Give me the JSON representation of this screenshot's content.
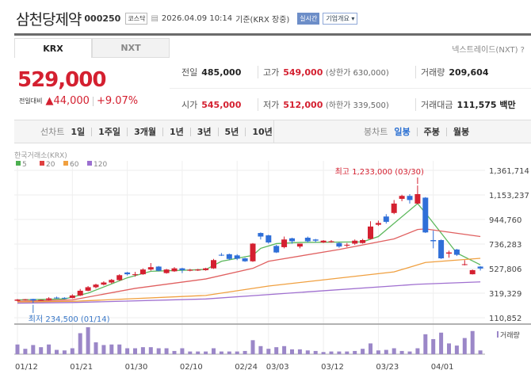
{
  "header": {
    "name": "삼천당제약",
    "code": "000250",
    "market": "코스닥",
    "datetime": "2026.04.09 10:14",
    "basis": "기준(KRX 장중)",
    "realtime": "실시간",
    "company_info": "기업개요 ▾"
  },
  "tabs": [
    {
      "label": "KRX",
      "active": true
    },
    {
      "label": "NXT",
      "active": false
    }
  ],
  "nxt_link": "넥스트레이드(NXT) ?",
  "quote": {
    "price": "529,000",
    "change_label": "전일대비",
    "change": "▲44,000",
    "change_pct": "+9.07%"
  },
  "stats": {
    "prev": {
      "k": "전일",
      "v": "485,000"
    },
    "high": {
      "k": "고가",
      "v": "549,000",
      "s": "(상한가 630,000)"
    },
    "volume": {
      "k": "거래량",
      "v": "209,604"
    },
    "open": {
      "k": "시가",
      "v": "545,000"
    },
    "low": {
      "k": "저가",
      "v": "512,000",
      "s": "(하한가 339,500)"
    },
    "amount": {
      "k": "거래대금",
      "v": "111,575 백만"
    }
  },
  "period_bar": {
    "line_label": "선차트",
    "line_items": [
      "1일",
      "1주일",
      "3개월",
      "1년",
      "3년",
      "5년",
      "10년"
    ],
    "candle_label": "봉차트",
    "candle_items": [
      "일봉",
      "주봉",
      "월봉"
    ],
    "selected": "일봉"
  },
  "colors": {
    "up": "#d42030",
    "down": "#2f6fd8",
    "ma5": "#5cb85c",
    "ma20": "#e06060",
    "ma60": "#f0a040",
    "ma120": "#a070d0",
    "volume": "#9b87c8"
  },
  "chart_data": {
    "type": "candlestick",
    "source": "한국거래소(KRX)",
    "legend": [
      {
        "name": "5",
        "color": "#4caf50"
      },
      {
        "name": "20",
        "color": "#e04040"
      },
      {
        "name": "60",
        "color": "#f0a040"
      },
      {
        "name": "120",
        "color": "#9b6fd0"
      }
    ],
    "y_ticks": [
      "1,361,714",
      "1,153,237",
      "944,760",
      "736,283",
      "527,806",
      "319,329",
      "110,852"
    ],
    "ylim": [
      110852,
      1361714
    ],
    "x_ticks": [
      "01/12",
      "01/21",
      "01/30",
      "02/10",
      "02/24",
      "03/03",
      "03/12",
      "03/23",
      "04/01"
    ],
    "dates": [
      "01/12",
      "01/13",
      "01/14",
      "01/15",
      "01/16",
      "01/19",
      "01/20",
      "01/21",
      "01/22",
      "01/23",
      "01/26",
      "01/27",
      "01/28",
      "01/29",
      "01/30",
      "02/02",
      "02/03",
      "02/04",
      "02/05",
      "02/06",
      "02/09",
      "02/10",
      "02/11",
      "02/12",
      "02/13",
      "02/19",
      "02/20",
      "02/23",
      "02/24",
      "02/25",
      "02/26",
      "02/27",
      "03/03",
      "03/04",
      "03/05",
      "03/06",
      "03/09",
      "03/10",
      "03/11",
      "03/12",
      "03/13",
      "03/16",
      "03/17",
      "03/18",
      "03/19",
      "03/20",
      "03/23",
      "03/24",
      "03/25",
      "03/26",
      "03/27",
      "03/30",
      "03/31",
      "04/01",
      "04/02",
      "04/03",
      "04/06",
      "04/07",
      "04/08",
      "04/09"
    ],
    "ohlc": [
      [
        255000,
        270000,
        250000,
        265000
      ],
      [
        262000,
        270000,
        258000,
        268000
      ],
      [
        270000,
        272000,
        234500,
        258000
      ],
      [
        260000,
        265000,
        255000,
        262000
      ],
      [
        262000,
        285000,
        258000,
        275000
      ],
      [
        282000,
        290000,
        272000,
        278000
      ],
      [
        280000,
        285000,
        270000,
        276000
      ],
      [
        278000,
        310000,
        275000,
        300000
      ],
      [
        300000,
        355000,
        295000,
        340000
      ],
      [
        340000,
        380000,
        335000,
        370000
      ],
      [
        370000,
        400000,
        360000,
        392000
      ],
      [
        392000,
        420000,
        385000,
        410000
      ],
      [
        410000,
        440000,
        400000,
        432000
      ],
      [
        430000,
        480000,
        425000,
        472000
      ],
      [
        495000,
        500000,
        470000,
        480000
      ],
      [
        475000,
        500000,
        460000,
        480000
      ],
      [
        480000,
        530000,
        475000,
        520000
      ],
      [
        520000,
        575000,
        510000,
        540000
      ],
      [
        545000,
        550000,
        505000,
        510000
      ],
      [
        490000,
        525000,
        485000,
        520000
      ],
      [
        505000,
        540000,
        500000,
        530000
      ],
      [
        530000,
        535000,
        490000,
        515000
      ],
      [
        510000,
        525000,
        505000,
        518000
      ],
      [
        512000,
        525000,
        508000,
        520000
      ],
      [
        515000,
        535000,
        510000,
        530000
      ],
      [
        530000,
        610000,
        525000,
        600000
      ],
      [
        645000,
        660000,
        635000,
        642000
      ],
      [
        650000,
        655000,
        600000,
        610000
      ],
      [
        640000,
        650000,
        600000,
        612000
      ],
      [
        615000,
        620000,
        585000,
        590000
      ],
      [
        590000,
        745000,
        585000,
        740000
      ],
      [
        830000,
        835000,
        775000,
        800000
      ],
      [
        810000,
        815000,
        740000,
        750000
      ],
      [
        720000,
        730000,
        660000,
        665000
      ],
      [
        710000,
        800000,
        700000,
        775000
      ],
      [
        785000,
        790000,
        740000,
        760000
      ],
      [
        715000,
        740000,
        700000,
        740000
      ],
      [
        790000,
        800000,
        750000,
        760000
      ],
      [
        775000,
        780000,
        750000,
        765000
      ],
      [
        750000,
        770000,
        745000,
        765000
      ],
      [
        752000,
        770000,
        748000,
        760000
      ],
      [
        745000,
        750000,
        705000,
        715000
      ],
      [
        725000,
        745000,
        710000,
        730000
      ],
      [
        740000,
        775000,
        730000,
        765000
      ],
      [
        745000,
        780000,
        740000,
        770000
      ],
      [
        780000,
        930000,
        775000,
        885000
      ],
      [
        900000,
        935000,
        890000,
        915000
      ],
      [
        970000,
        990000,
        910000,
        925000
      ],
      [
        1000000,
        1110000,
        990000,
        1080000
      ],
      [
        1120000,
        1155000,
        1100000,
        1145000
      ],
      [
        1145000,
        1160000,
        1080000,
        1110000
      ],
      [
        1080000,
        1233000,
        1075000,
        1160000
      ],
      [
        1130000,
        1135000,
        830000,
        835000
      ],
      [
        770000,
        850000,
        700000,
        760000
      ],
      [
        770000,
        775000,
        610000,
        615000
      ],
      [
        655000,
        680000,
        620000,
        665000
      ],
      [
        690000,
        695000,
        635000,
        645000
      ],
      [
        560000,
        600000,
        555000,
        565000
      ],
      [
        480000,
        520000,
        478000,
        515000
      ],
      [
        545000,
        549000,
        512000,
        529000
      ]
    ],
    "ma": {
      "5": [
        [
          "01/12",
          262000
        ],
        [
          "01/20",
          270000
        ],
        [
          "01/23",
          320000
        ],
        [
          "01/30",
          450000
        ],
        [
          "02/04",
          505000
        ],
        [
          "02/13",
          520000
        ],
        [
          "02/20",
          590000
        ],
        [
          "02/26",
          640000
        ],
        [
          "02/27",
          700000
        ],
        [
          "03/04",
          740000
        ],
        [
          "03/09",
          750000
        ],
        [
          "03/19",
          755000
        ],
        [
          "03/23",
          800000
        ],
        [
          "03/30",
          1080000
        ],
        [
          "03/31",
          1000000
        ],
        [
          "04/06",
          660000
        ],
        [
          "04/09",
          560000
        ]
      ],
      "20": [
        [
          "01/12",
          250000
        ],
        [
          "01/21",
          262000
        ],
        [
          "02/02",
          360000
        ],
        [
          "02/13",
          440000
        ],
        [
          "02/26",
          530000
        ],
        [
          "03/03",
          590000
        ],
        [
          "03/16",
          690000
        ],
        [
          "03/25",
          780000
        ],
        [
          "03/30",
          860000
        ],
        [
          "03/31",
          865000
        ],
        [
          "04/09",
          800000
        ]
      ],
      "60": [
        [
          "01/12",
          245000
        ],
        [
          "01/21",
          250000
        ],
        [
          "02/13",
          300000
        ],
        [
          "03/03",
          380000
        ],
        [
          "03/25",
          500000
        ],
        [
          "03/31",
          580000
        ],
        [
          "04/09",
          615000
        ]
      ],
      "120": [
        [
          "01/12",
          235000
        ],
        [
          "01/21",
          240000
        ],
        [
          "02/13",
          270000
        ],
        [
          "03/12",
          340000
        ],
        [
          "03/30",
          395000
        ],
        [
          "04/09",
          415000
        ]
      ]
    },
    "annotations": {
      "high": "최고 1,233,000 (03/30)",
      "low": "최저 234,500 (01/14)"
    },
    "volume_label": "거래량",
    "volume": [
      36,
      20,
      34,
      26,
      36,
      16,
      14,
      22,
      78,
      100,
      44,
      34,
      36,
      36,
      22,
      22,
      26,
      26,
      22,
      22,
      12,
      22,
      10,
      10,
      10,
      22,
      10,
      10,
      10,
      12,
      52,
      30,
      20,
      26,
      30,
      18,
      18,
      14,
      12,
      8,
      10,
      10,
      10,
      12,
      20,
      40,
      14,
      16,
      22,
      12,
      10,
      22,
      74,
      56,
      80,
      40,
      32,
      60,
      86,
      14
    ]
  }
}
